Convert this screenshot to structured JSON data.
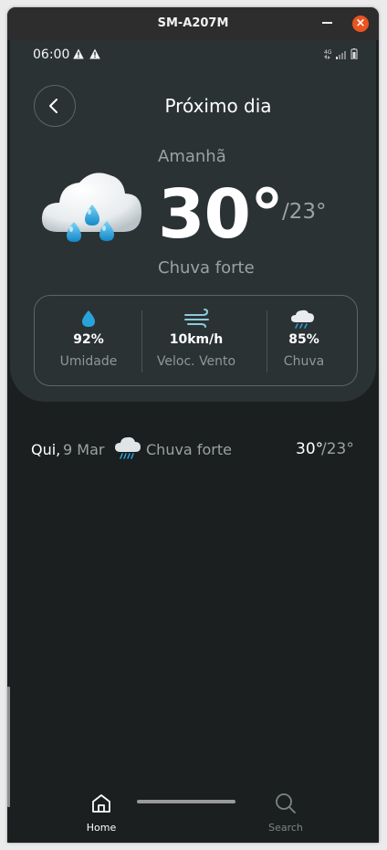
{
  "window": {
    "title": "SM-A207M"
  },
  "status_bar": {
    "time": "06:00",
    "network": "4G"
  },
  "header": {
    "title": "Próximo dia"
  },
  "current": {
    "day": "Amanhã",
    "temp_high": "30°",
    "temp_low": "/23°",
    "condition": "Chuva forte",
    "icon": "heavy-rain-cloud-icon"
  },
  "stats": [
    {
      "value": "92%",
      "label": "Umidade",
      "icon": "water-drop-icon"
    },
    {
      "value": "10km/h",
      "label": "Veloc. Vento",
      "icon": "wind-icon"
    },
    {
      "value": "85%",
      "label": "Chuva",
      "icon": "rain-cloud-icon"
    }
  ],
  "forecast": [
    {
      "day": "Qui,",
      "date": "9 Mar",
      "condition": "Chuva forte",
      "high": "30°",
      "low": "/23°",
      "icon": "rain-cloud-icon"
    }
  ],
  "nav": [
    {
      "label": "Home",
      "icon": "home-icon",
      "active": true
    },
    {
      "label": "Search",
      "icon": "search-icon",
      "active": false
    }
  ],
  "colors": {
    "background": "#1b1f20",
    "card": "#2b3234",
    "text_primary": "#ffffff",
    "text_secondary": "#9aa2a4",
    "accent_blue": "#29a3dc"
  }
}
